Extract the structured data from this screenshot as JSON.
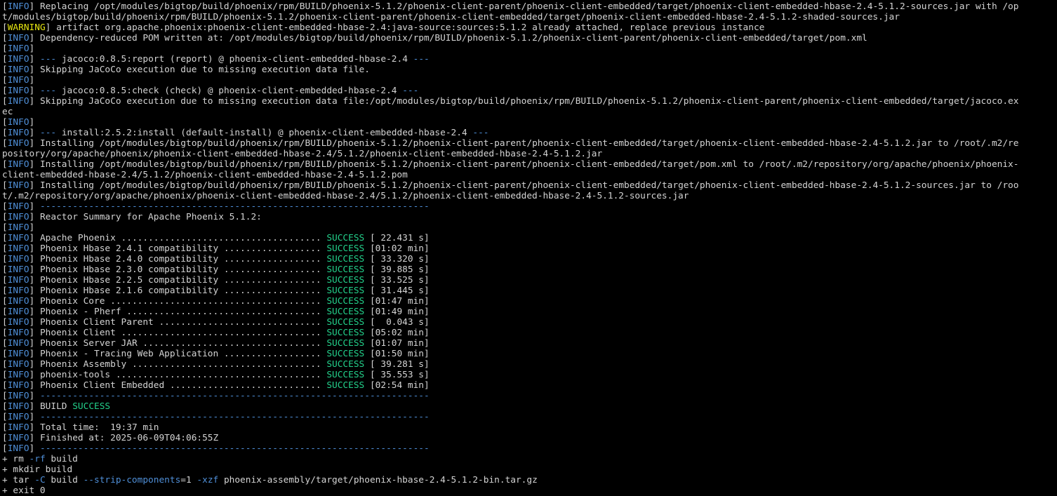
{
  "terminal": {
    "lines": [
      {
        "kind": "info",
        "parts": [
          {
            "t": "text",
            "v": " Replacing /opt/modules/bigtop/build/phoenix/rpm/BUILD/phoenix-5.1.2/phoenix-client-parent/phoenix-client-embedded/target/phoenix-client-embedded-hbase-2.4-5.1.2-sources.jar with /op"
          }
        ]
      },
      {
        "kind": "plain",
        "parts": [
          {
            "t": "text",
            "v": "t/modules/bigtop/build/phoenix/rpm/BUILD/phoenix-5.1.2/phoenix-client-parent/phoenix-client-embedded/target/phoenix-client-embedded-hbase-2.4-5.1.2-shaded-sources.jar"
          }
        ]
      },
      {
        "kind": "warning",
        "parts": [
          {
            "t": "text",
            "v": " artifact org.apache.phoenix:phoenix-client-embedded-hbase-2.4:java-source:sources:5.1.2 already attached, replace previous instance"
          }
        ]
      },
      {
        "kind": "info",
        "parts": [
          {
            "t": "text",
            "v": " Dependency-reduced POM written at: /opt/modules/bigtop/build/phoenix/rpm/BUILD/phoenix-5.1.2/phoenix-client-parent/phoenix-client-embedded/target/pom.xml"
          }
        ]
      },
      {
        "kind": "info",
        "parts": []
      },
      {
        "kind": "info",
        "parts": [
          {
            "t": "text",
            "v": " "
          },
          {
            "t": "dash",
            "v": "---"
          },
          {
            "t": "text",
            "v": " jacoco:0.8.5:report (report) @ phoenix-client-embedded-hbase-2.4 "
          },
          {
            "t": "dash",
            "v": "---"
          }
        ]
      },
      {
        "kind": "info",
        "parts": [
          {
            "t": "text",
            "v": " Skipping JaCoCo execution due to missing execution data file."
          }
        ]
      },
      {
        "kind": "info",
        "parts": []
      },
      {
        "kind": "info",
        "parts": [
          {
            "t": "text",
            "v": " "
          },
          {
            "t": "dash",
            "v": "---"
          },
          {
            "t": "text",
            "v": " jacoco:0.8.5:check (check) @ phoenix-client-embedded-hbase-2.4 "
          },
          {
            "t": "dash",
            "v": "---"
          }
        ]
      },
      {
        "kind": "info",
        "parts": [
          {
            "t": "text",
            "v": " Skipping JaCoCo execution due to missing execution data file:/opt/modules/bigtop/build/phoenix/rpm/BUILD/phoenix-5.1.2/phoenix-client-parent/phoenix-client-embedded/target/jacoco.ex"
          }
        ]
      },
      {
        "kind": "plain",
        "parts": [
          {
            "t": "text",
            "v": "ec"
          }
        ]
      },
      {
        "kind": "info",
        "parts": []
      },
      {
        "kind": "info",
        "parts": [
          {
            "t": "text",
            "v": " "
          },
          {
            "t": "dash",
            "v": "---"
          },
          {
            "t": "text",
            "v": " install:2.5.2:install (default-install) @ phoenix-client-embedded-hbase-2.4 "
          },
          {
            "t": "dash",
            "v": "---"
          }
        ]
      },
      {
        "kind": "info",
        "parts": [
          {
            "t": "text",
            "v": " Installing /opt/modules/bigtop/build/phoenix/rpm/BUILD/phoenix-5.1.2/phoenix-client-parent/phoenix-client-embedded/target/phoenix-client-embedded-hbase-2.4-5.1.2.jar to /root/.m2/re"
          }
        ]
      },
      {
        "kind": "plain",
        "parts": [
          {
            "t": "text",
            "v": "pository/org/apache/phoenix/phoenix-client-embedded-hbase-2.4/5.1.2/phoenix-client-embedded-hbase-2.4-5.1.2.jar"
          }
        ]
      },
      {
        "kind": "info",
        "parts": [
          {
            "t": "text",
            "v": " Installing /opt/modules/bigtop/build/phoenix/rpm/BUILD/phoenix-5.1.2/phoenix-client-parent/phoenix-client-embedded/target/pom.xml to /root/.m2/repository/org/apache/phoenix/phoenix-"
          }
        ]
      },
      {
        "kind": "plain",
        "parts": [
          {
            "t": "text",
            "v": "client-embedded-hbase-2.4/5.1.2/phoenix-client-embedded-hbase-2.4-5.1.2.pom"
          }
        ]
      },
      {
        "kind": "info",
        "parts": [
          {
            "t": "text",
            "v": " Installing /opt/modules/bigtop/build/phoenix/rpm/BUILD/phoenix-5.1.2/phoenix-client-parent/phoenix-client-embedded/target/phoenix-client-embedded-hbase-2.4-5.1.2-sources.jar to /roo"
          }
        ]
      },
      {
        "kind": "plain",
        "parts": [
          {
            "t": "text",
            "v": "t/.m2/repository/org/apache/phoenix/phoenix-client-embedded-hbase-2.4/5.1.2/phoenix-client-embedded-hbase-2.4-5.1.2-sources.jar"
          }
        ]
      },
      {
        "kind": "info",
        "parts": [
          {
            "t": "text",
            "v": " "
          },
          {
            "t": "dash",
            "v": "------------------------------------------------------------------------"
          }
        ]
      },
      {
        "kind": "info",
        "parts": [
          {
            "t": "text",
            "v": " Reactor Summary for Apache Phoenix 5.1.2:"
          }
        ]
      },
      {
        "kind": "info",
        "parts": []
      },
      {
        "kind": "info",
        "parts": [
          {
            "t": "text",
            "v": " Apache Phoenix ..................................... "
          },
          {
            "t": "success",
            "v": "SUCCESS"
          },
          {
            "t": "text",
            "v": " [ 22.431 s]"
          }
        ]
      },
      {
        "kind": "info",
        "parts": [
          {
            "t": "text",
            "v": " Phoenix Hbase 2.4.1 compatibility .................. "
          },
          {
            "t": "success",
            "v": "SUCCESS"
          },
          {
            "t": "text",
            "v": " [01:02 min]"
          }
        ]
      },
      {
        "kind": "info",
        "parts": [
          {
            "t": "text",
            "v": " Phoenix Hbase 2.4.0 compatibility .................. "
          },
          {
            "t": "success",
            "v": "SUCCESS"
          },
          {
            "t": "text",
            "v": " [ 33.320 s]"
          }
        ]
      },
      {
        "kind": "info",
        "parts": [
          {
            "t": "text",
            "v": " Phoenix Hbase 2.3.0 compatibility .................. "
          },
          {
            "t": "success",
            "v": "SUCCESS"
          },
          {
            "t": "text",
            "v": " [ 39.885 s]"
          }
        ]
      },
      {
        "kind": "info",
        "parts": [
          {
            "t": "text",
            "v": " Phoenix Hbase 2.2.5 compatibility .................. "
          },
          {
            "t": "success",
            "v": "SUCCESS"
          },
          {
            "t": "text",
            "v": " [ 33.525 s]"
          }
        ]
      },
      {
        "kind": "info",
        "parts": [
          {
            "t": "text",
            "v": " Phoenix Hbase 2.1.6 compatibility .................. "
          },
          {
            "t": "success",
            "v": "SUCCESS"
          },
          {
            "t": "text",
            "v": " [ 31.445 s]"
          }
        ]
      },
      {
        "kind": "info",
        "parts": [
          {
            "t": "text",
            "v": " Phoenix Core ....................................... "
          },
          {
            "t": "success",
            "v": "SUCCESS"
          },
          {
            "t": "text",
            "v": " [01:47 min]"
          }
        ]
      },
      {
        "kind": "info",
        "parts": [
          {
            "t": "text",
            "v": " Phoenix - Pherf .................................... "
          },
          {
            "t": "success",
            "v": "SUCCESS"
          },
          {
            "t": "text",
            "v": " [01:49 min]"
          }
        ]
      },
      {
        "kind": "info",
        "parts": [
          {
            "t": "text",
            "v": " Phoenix Client Parent .............................. "
          },
          {
            "t": "success",
            "v": "SUCCESS"
          },
          {
            "t": "text",
            "v": " [  0.043 s]"
          }
        ]
      },
      {
        "kind": "info",
        "parts": [
          {
            "t": "text",
            "v": " Phoenix Client ..................................... "
          },
          {
            "t": "success",
            "v": "SUCCESS"
          },
          {
            "t": "text",
            "v": " [05:02 min]"
          }
        ]
      },
      {
        "kind": "info",
        "parts": [
          {
            "t": "text",
            "v": " Phoenix Server JAR ................................. "
          },
          {
            "t": "success",
            "v": "SUCCESS"
          },
          {
            "t": "text",
            "v": " [01:07 min]"
          }
        ]
      },
      {
        "kind": "info",
        "parts": [
          {
            "t": "text",
            "v": " Phoenix - Tracing Web Application .................. "
          },
          {
            "t": "success",
            "v": "SUCCESS"
          },
          {
            "t": "text",
            "v": " [01:50 min]"
          }
        ]
      },
      {
        "kind": "info",
        "parts": [
          {
            "t": "text",
            "v": " Phoenix Assembly ................................... "
          },
          {
            "t": "success",
            "v": "SUCCESS"
          },
          {
            "t": "text",
            "v": " [ 39.281 s]"
          }
        ]
      },
      {
        "kind": "info",
        "parts": [
          {
            "t": "text",
            "v": " phoenix-tools ...................................... "
          },
          {
            "t": "success",
            "v": "SUCCESS"
          },
          {
            "t": "text",
            "v": " [ 35.553 s]"
          }
        ]
      },
      {
        "kind": "info",
        "parts": [
          {
            "t": "text",
            "v": " Phoenix Client Embedded ............................ "
          },
          {
            "t": "success",
            "v": "SUCCESS"
          },
          {
            "t": "text",
            "v": " [02:54 min]"
          }
        ]
      },
      {
        "kind": "info",
        "parts": [
          {
            "t": "text",
            "v": " "
          },
          {
            "t": "dash",
            "v": "------------------------------------------------------------------------"
          }
        ]
      },
      {
        "kind": "info",
        "parts": [
          {
            "t": "text",
            "v": " BUILD "
          },
          {
            "t": "success",
            "v": "SUCCESS"
          }
        ]
      },
      {
        "kind": "info",
        "parts": [
          {
            "t": "text",
            "v": " "
          },
          {
            "t": "dash",
            "v": "------------------------------------------------------------------------"
          }
        ]
      },
      {
        "kind": "info",
        "parts": [
          {
            "t": "text",
            "v": " Total time:  19:37 min"
          }
        ]
      },
      {
        "kind": "info",
        "parts": [
          {
            "t": "text",
            "v": " Finished at: 2025-06-09T04:06:55Z"
          }
        ]
      },
      {
        "kind": "info",
        "parts": [
          {
            "t": "text",
            "v": " "
          },
          {
            "t": "dash",
            "v": "------------------------------------------------------------------------"
          }
        ]
      },
      {
        "kind": "plain",
        "parts": [
          {
            "t": "text",
            "v": "+ rm "
          },
          {
            "t": "opt",
            "v": "-rf"
          },
          {
            "t": "text",
            "v": " build"
          }
        ]
      },
      {
        "kind": "plain",
        "parts": [
          {
            "t": "text",
            "v": "+ mkdir build"
          }
        ]
      },
      {
        "kind": "plain",
        "parts": [
          {
            "t": "text",
            "v": "+ tar "
          },
          {
            "t": "opt",
            "v": "-C"
          },
          {
            "t": "text",
            "v": " build "
          },
          {
            "t": "opt",
            "v": "--strip-components"
          },
          {
            "t": "text",
            "v": "=1 "
          },
          {
            "t": "opt",
            "v": "-xzf"
          },
          {
            "t": "text",
            "v": " phoenix-assembly/target/phoenix-hbase-2.4-5.1.2-bin.tar.gz"
          }
        ]
      },
      {
        "kind": "plain",
        "parts": [
          {
            "t": "text",
            "v": "+ exit 0"
          }
        ]
      }
    ],
    "tags": {
      "info": "INFO",
      "warning": "WARNING"
    },
    "colors": {
      "background": "#000000",
      "foreground": "#d4d4d4",
      "info_tag": "#4f8fd8",
      "warning_tag": "#e5e510",
      "success": "#23d18b",
      "dash": "#4f8fd8",
      "option": "#4f8fd8"
    }
  }
}
